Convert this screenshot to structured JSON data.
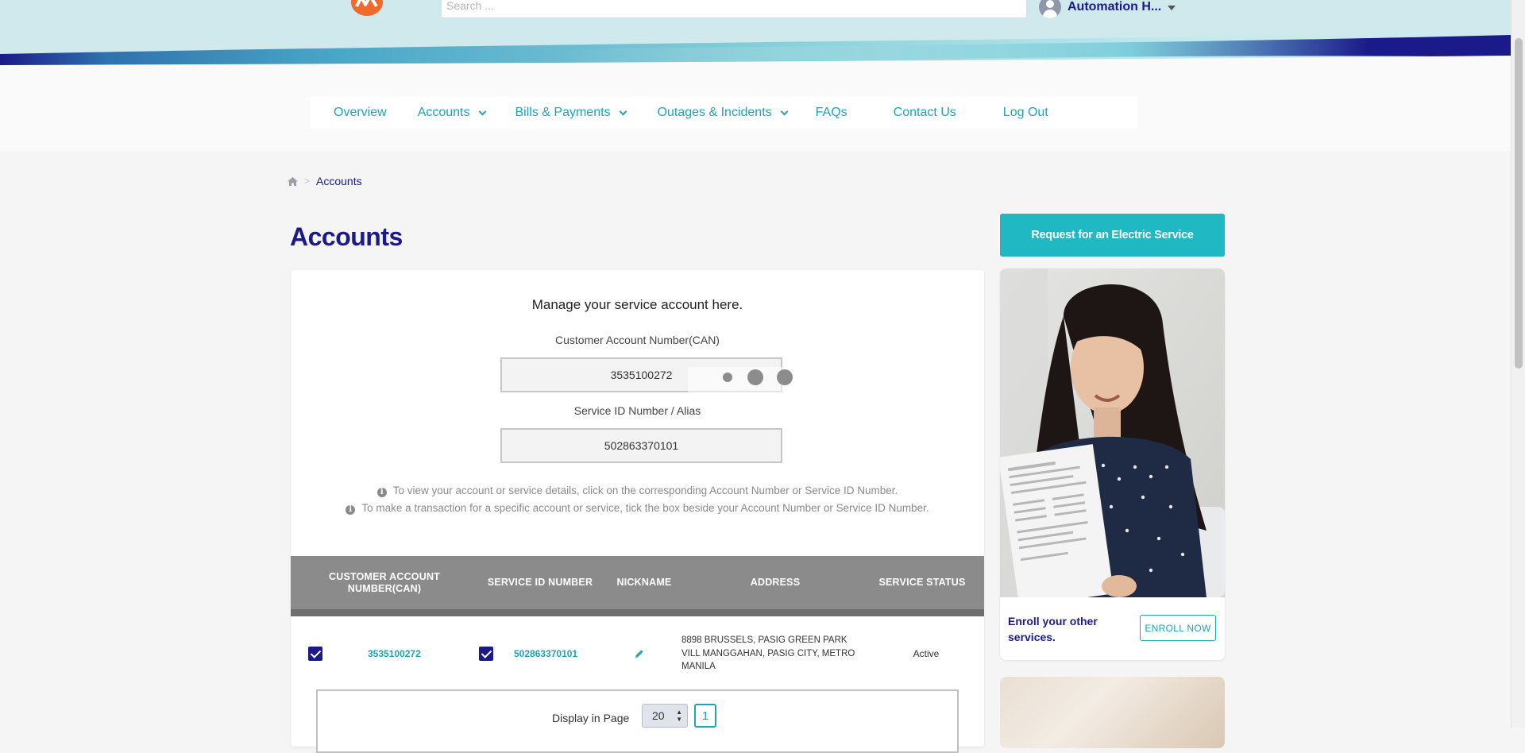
{
  "header": {
    "search": {
      "placeholder": "Search ..."
    },
    "user": {
      "name": "Automation H..."
    }
  },
  "nav": {
    "items": [
      {
        "label": "Overview",
        "has_dropdown": false
      },
      {
        "label": "Accounts",
        "has_dropdown": true
      },
      {
        "label": "Bills & Payments",
        "has_dropdown": true
      },
      {
        "label": "Outages & Incidents",
        "has_dropdown": true
      },
      {
        "label": "FAQs",
        "has_dropdown": false
      },
      {
        "label": "Contact Us",
        "has_dropdown": false
      },
      {
        "label": "Log Out",
        "has_dropdown": false
      }
    ]
  },
  "breadcrumb": {
    "home_icon": "home-icon",
    "current": "Accounts"
  },
  "page": {
    "title": "Accounts"
  },
  "main": {
    "heading": "Manage your service account here.",
    "can_label": "Customer Account Number(CAN)",
    "can_value": "3535100272",
    "service_label": "Service ID Number / Alias",
    "service_value": "502863370101",
    "info_1": "To view your account or service details, click on the corresponding Account Number or Service ID Number.",
    "info_2": "To make a transaction for a specific account or service, tick the box beside your Account Number or Service ID Number."
  },
  "table": {
    "headers": {
      "can": "CUSTOMER ACCOUNT NUMBER(CAN)",
      "service_id": "SERVICE ID NUMBER",
      "nickname": "NICKNAME",
      "address": "ADDRESS",
      "status": "SERVICE STATUS"
    },
    "rows": [
      {
        "can_checked": true,
        "can": "3535100272",
        "service_checked": true,
        "service_id": "502863370101",
        "nickname_icon": "pencil-icon",
        "address": "8898 BRUSSELS, PASIG GREEN PARK VILL MANGGAHAN, PASIG CITY, METRO MANILA",
        "status": "Active"
      }
    ]
  },
  "pagination": {
    "label": "Display in Page",
    "page_size": "20",
    "current_page": "1"
  },
  "sidebar": {
    "request_button": "Request for an Electric Service",
    "promo_text": "Enroll your other services.",
    "enroll_button": "ENROLL NOW"
  },
  "colors": {
    "brand_navy": "#1b1a8a",
    "brand_teal": "#1aa6b7",
    "button_teal": "#1fb8c3",
    "logo_orange": "#f06a2c"
  }
}
